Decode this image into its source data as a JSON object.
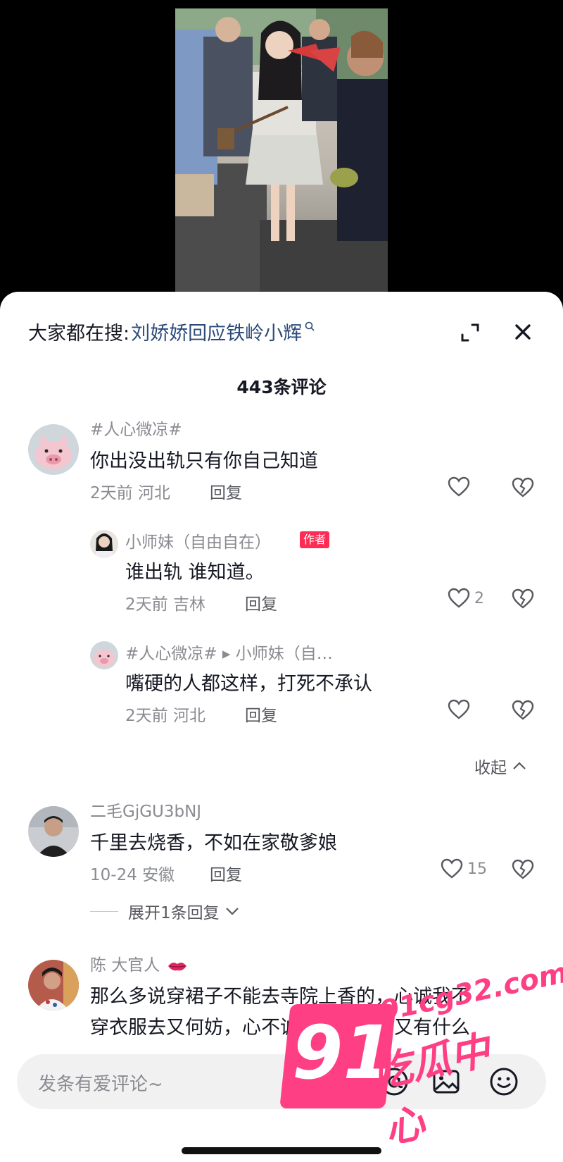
{
  "search": {
    "prefix": "大家都在搜:",
    "term": "刘娇娇回应铁岭小辉"
  },
  "comments_count": "443条评论",
  "comments": [
    {
      "user": "#人心微凉#",
      "text": "你出没出轨只有你自己知道",
      "meta": "2天前 河北",
      "reply_label": "回复",
      "likes": "",
      "replies": [
        {
          "user": "小师妹（自由自在）",
          "badge": "作者",
          "text": "谁出轨 谁知道。",
          "meta": "2天前 吉林",
          "reply_label": "回复",
          "likes": "2"
        },
        {
          "user": "#人心微凉# ▸ 小师妹（自…",
          "text": "嘴硬的人都这样，打死不承认",
          "meta": "2天前 河北",
          "reply_label": "回复",
          "likes": ""
        }
      ],
      "collapse_label": "收起"
    },
    {
      "user": "二毛GjGU3bNJ",
      "text": "千里去烧香，不如在家敬爹娘",
      "meta": "10-24 安徽",
      "reply_label": "回复",
      "likes": "15",
      "expand_label": "展开1条回复"
    },
    {
      "user": "陈 大官人",
      "text_line1": "那么多说穿裙子不能去寺院上香的，心诚我不",
      "text_line2": "穿衣服去又何妨，心不诚我多穿几件又有什么"
    }
  ],
  "input": {
    "placeholder": "发条有爱评论~"
  },
  "watermark": {
    "number": "91",
    "url": "91cg32.com",
    "name": "吃瓜中心"
  },
  "icons": {
    "expand": "expand-icon",
    "close": "close-icon",
    "like": "heart-outline-icon",
    "dislike": "broken-heart-icon",
    "mention": "at-icon",
    "image": "image-icon",
    "emoji": "emoji-icon"
  },
  "colors": {
    "author_badge": "#fe2c55",
    "search_link": "#2b4a7a",
    "secondary_text": "#8a8b91",
    "watermark": "#ff3f84"
  }
}
